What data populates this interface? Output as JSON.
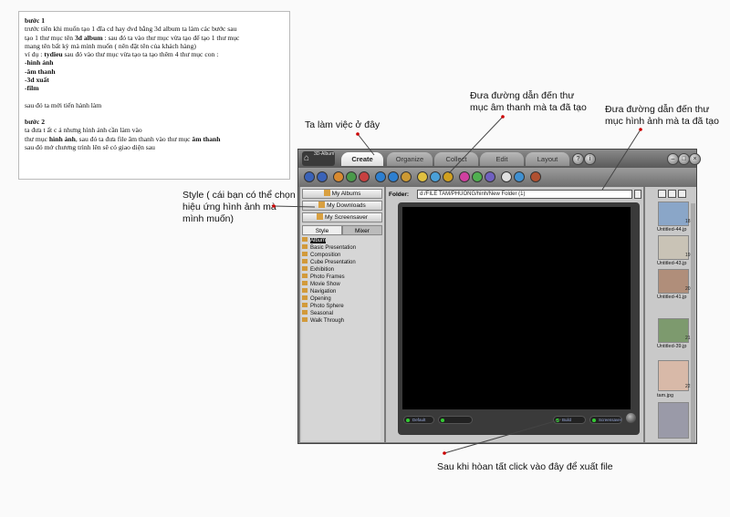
{
  "instructions": {
    "step1_title": "bước 1",
    "step1_line1": "trước tiên khi muốn tạo 1 đĩa cd hay dvd bằng  3d album ta làm các bước sau",
    "step1_line2a": "tạo 1 thư mục  tên ",
    "step1_line2b": "3d album",
    "step1_line2c": "  : sau đó ta vào thư mục vừa tạo để tạo 1 thư mục",
    "step1_line3": "mang tên bất kỳ mà mình muốn ( nên đặt tên của khách hàng)",
    "step1_line4a": "ví dụ :   ",
    "step1_line4b": "tydieu",
    "step1_line4c": " sau đó vào thư mục vừa tạo ta tạo thêm 4 thư mục con :",
    "folders": [
      "-hình ảnh",
      "-âm thanh",
      "-3d xuất",
      "-film"
    ],
    "step1_end": "sau đó ta mới tiến hành làm",
    "step2_title": "bước 2",
    "step2_line1": "ta đưa t ất c ả nhưng hình ảnh  cần làm vào",
    "step2_line2a": "thư mục ",
    "step2_line2b": "hình ảnh",
    "step2_line2c": ", sau đó ta đưa file âm thanh vào thư mục ",
    "step2_line2d": "âm thanh",
    "step2_line3": "sau đó mở chương trình lên sẽ có giao diện sau"
  },
  "annotations": {
    "sound_path": "Đưa đường dẫn đến thư mục âm thanh mà ta đã tạo",
    "image_path": "Đưa đường dẫn đến thư mục hình ảnh mà ta đã tạo",
    "work_here": "Ta làm việc ở đây",
    "style_note": "Style ( cái bạn có thể chọn hiệu ứng hình ảnh mà mình muốn)",
    "export_note": "Sau khi hòan tất click vào đây để xuất file"
  },
  "app": {
    "logo": "3D-Album",
    "tabs": [
      "Create",
      "Organize",
      "Collect",
      "Edit",
      "Layout"
    ],
    "active_tab": "Create",
    "left_buttons": [
      "My Albums",
      "My Downloads",
      "My Screensaver"
    ],
    "style_tabs": [
      "Style",
      "Mixer"
    ],
    "style_list": [
      "Album",
      "Basic Presentation",
      "Composition",
      "Cube Presentation",
      "Exhibition",
      "Photo Frames",
      "Movie Show",
      "Navigation",
      "Opening",
      "Photo Sphere",
      "Seasonal",
      "Walk Through"
    ],
    "selected_style": "Album",
    "folder_label": "Folder:",
    "folder_path": "d:/FILE TAM/PHUONG/hinh/New Folder (1)",
    "controls": {
      "default": "Default",
      "build": "Build",
      "screensaver": "Screensaver"
    },
    "thumbnails": [
      {
        "name": "Untitled-44.jp",
        "num": "18",
        "color": "#8aa6c8"
      },
      {
        "name": "Untitled-43.jp",
        "num": "19",
        "color": "#c9c3b6"
      },
      {
        "name": "Untitled-41.jp",
        "num": "20",
        "color": "#b08e7a"
      },
      {
        "name": "Untitled-39.jp",
        "num": "21",
        "color": "#7d9a6e"
      },
      {
        "name": "tam.jpg",
        "num": "22",
        "color": "#d8b9a8"
      },
      {
        "name": "",
        "num": "",
        "color": "#9a9aa8"
      }
    ]
  }
}
